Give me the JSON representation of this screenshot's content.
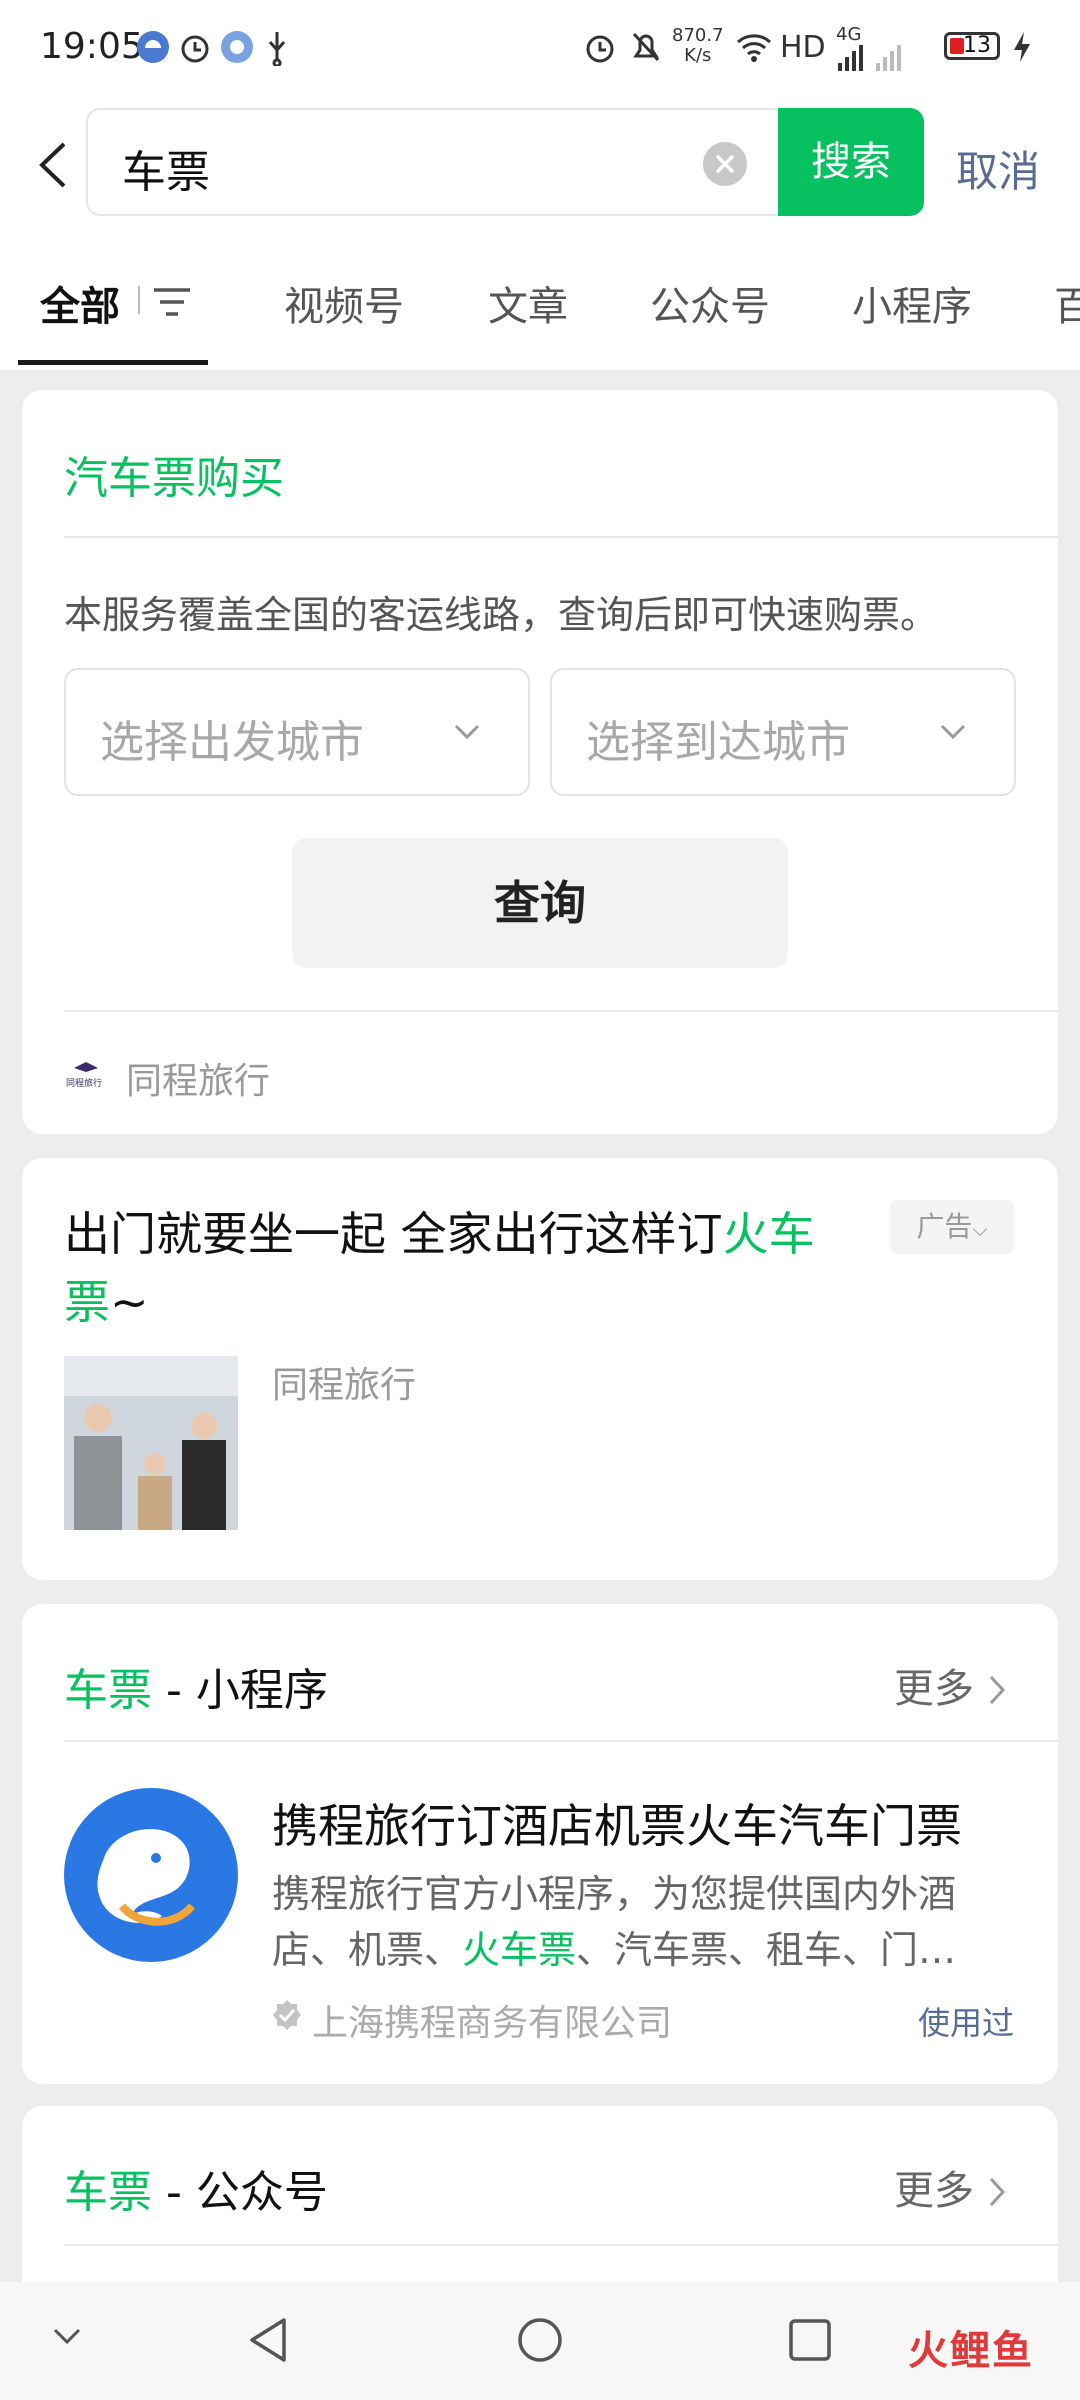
{
  "status_bar": {
    "time": "19:05",
    "net_speed_value": "870.7",
    "net_speed_unit": "K/s",
    "network": "HD",
    "network_4g": "4G",
    "battery": "13"
  },
  "search": {
    "query": "车票",
    "search_label": "搜索",
    "cancel_label": "取消"
  },
  "tabs": [
    {
      "label": "全部",
      "active": true
    },
    {
      "label": "视频号"
    },
    {
      "label": "文章"
    },
    {
      "label": "公众号"
    },
    {
      "label": "小程序"
    },
    {
      "label": "百"
    }
  ],
  "bus_card": {
    "title": "汽车票购买",
    "description": "本服务覆盖全国的客运线路，查询后即可快速购票。",
    "from_placeholder": "选择出发城市",
    "to_placeholder": "选择到达城市",
    "query_label": "查询",
    "provider_logo_text": "同程旅行",
    "provider": "同程旅行"
  },
  "ad_card": {
    "title_part1": "出门就要坐一起 全家出行这样订",
    "title_highlight1": "火车",
    "title_highlight2": "票",
    "title_tail": "~",
    "badge": "广告",
    "advertiser": "同程旅行"
  },
  "mini_program_section": {
    "keyword": "车票",
    "suffix": " - 小程序",
    "more_label": "更多",
    "item": {
      "name": "携程旅行订酒店机票火车汽车门票",
      "desc_line1": "携程旅行官方小程序，为您提供国内外酒",
      "desc_line2_a": "店、机票、",
      "desc_line2_highlight": "火车票",
      "desc_line2_b": "、汽车票、租车、门…",
      "company": "上海携程商务有限公司",
      "used_label": "使用过"
    }
  },
  "official_account_section": {
    "keyword": "车票",
    "suffix": " - 公众号",
    "more_label": "更多"
  },
  "watermark": "火鲤鱼",
  "colors": {
    "accent_green": "#07c160",
    "link_blue": "#576b95",
    "background": "#ededed"
  }
}
